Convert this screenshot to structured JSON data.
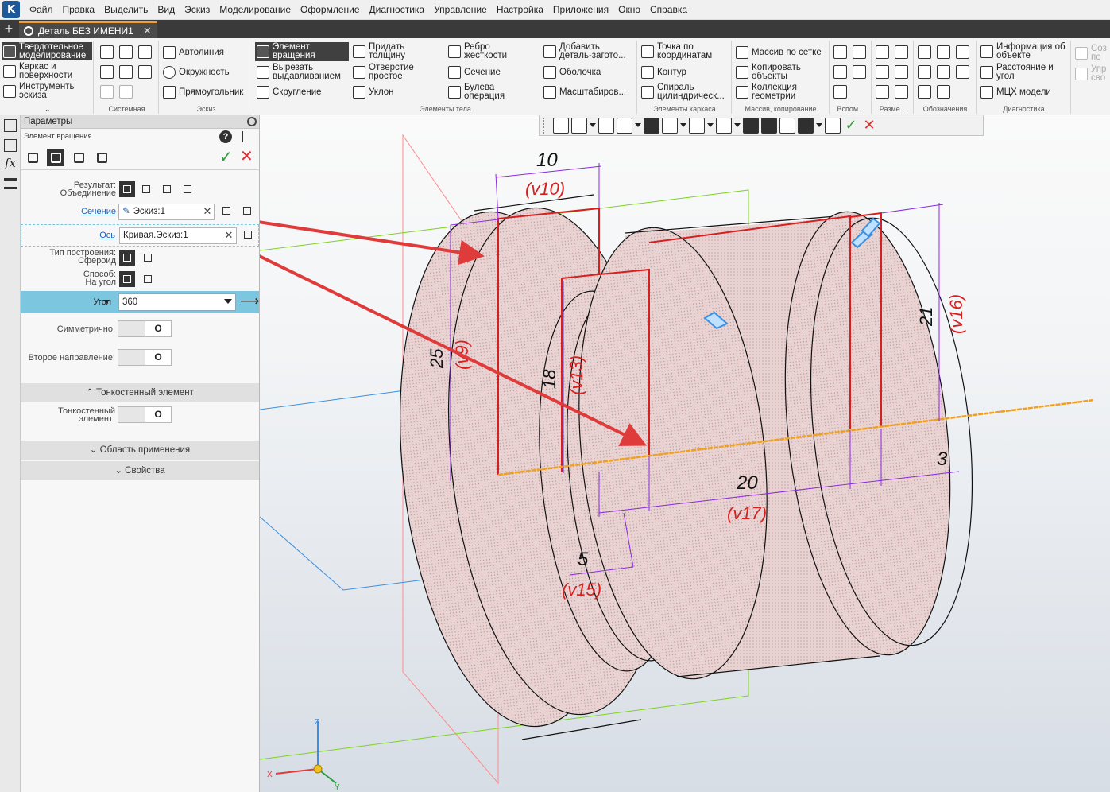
{
  "app": {
    "logo_letter": "K",
    "menu": [
      "Файл",
      "Правка",
      "Выделить",
      "Вид",
      "Эскиз",
      "Моделирование",
      "Оформление",
      "Диагностика",
      "Управление",
      "Настройка",
      "Приложения",
      "Окно",
      "Справка"
    ],
    "tab_title": "Деталь БЕЗ ИМЕНИ1",
    "tab_close": "✕"
  },
  "ribbon": {
    "modes": [
      {
        "label": "Твердотельное моделирование",
        "active": true
      },
      {
        "label": "Каркас и поверхности",
        "active": false
      },
      {
        "label": "Инструменты эскиза",
        "active": false
      }
    ],
    "groups": {
      "system": "Системная",
      "sketch": "Эскиз",
      "body": "Элементы тела",
      "frame": "Элементы каркаса",
      "array": "Массив, копирование",
      "aux": "Вспом...",
      "dim": "Разме...",
      "notation": "Обозначения",
      "diag": "Диагностика"
    },
    "sketch_buttons": [
      "Автолиния",
      "Окружность",
      "Прямоугольник"
    ],
    "body_buttons": [
      [
        "Элемент вращения",
        "Вырезать выдавливанием",
        "Скругление"
      ],
      [
        "Придать толщину",
        "Отверстие простое",
        "Уклон"
      ],
      [
        "Ребро жесткости",
        "Сечение",
        "Булева операция"
      ],
      [
        "Добавить деталь-загото...",
        "Оболочка",
        "Масштабиров..."
      ]
    ],
    "frame_buttons": [
      "Точка по координатам",
      "Контур",
      "Спираль цилиндрическ..."
    ],
    "array_buttons": [
      "Массив по сетке",
      "Копировать объекты",
      "Коллекция геометрии"
    ],
    "diag_buttons": [
      "Информация об объекте",
      "Расстояние и угол",
      "МЦХ модели"
    ],
    "right_cut": [
      "Соз по",
      "Упр сво"
    ]
  },
  "params": {
    "header": "Параметры",
    "operation": "Элемент вращения",
    "result_label": "Результат:",
    "result_value": "Объединение",
    "section_label": "Сечение",
    "section_value": "Эскиз:1",
    "axis_label": "Ось",
    "axis_value": "Кривая.Эскиз:1",
    "build_type_label": "Тип построения:",
    "build_type_value": "Сфероид",
    "method_label": "Способ:",
    "method_value": "На угол",
    "angle_label": "Угол",
    "angle_value": "360",
    "symmetric_label": "Симметрично:",
    "second_dir_label": "Второе направление:",
    "toggle_off": "O",
    "thin_section": "Тонкостенный элемент",
    "thin_label": "Тонкостенный элемент:",
    "apply_section": "Область применения",
    "props_section": "Свойства",
    "help": "?",
    "x_mark": "✕",
    "arrow_right": "⟶",
    "caret_up": "⌃",
    "caret_down": "⌄"
  },
  "view_toolbar": {
    "ok": "✓",
    "cancel": "✕"
  },
  "left_strip": {
    "fx": "fx"
  },
  "model_labels": {
    "d10": "10",
    "v10": "(v10)",
    "d25": "25",
    "v9": "(v9)",
    "d18": "18",
    "v13": "(v13)",
    "d21": "21",
    "v16": "(v16)",
    "d20": "20",
    "v17": "(v17)",
    "d5": "5",
    "v15": "(v15)",
    "d3": "3"
  },
  "axes": {
    "x": "X",
    "y": "Y",
    "z": "Z"
  },
  "colors": {
    "sketch_red": "#d81f1f",
    "axis_orange": "#f0a020",
    "dim_purple": "#8a2be2",
    "plane_blue": "#3a8fe0",
    "plane_green": "#7ed321",
    "plane_red": "#ff6f6f",
    "arrow_red": "#e03b3b",
    "accent_active": "#7cc6e0"
  }
}
